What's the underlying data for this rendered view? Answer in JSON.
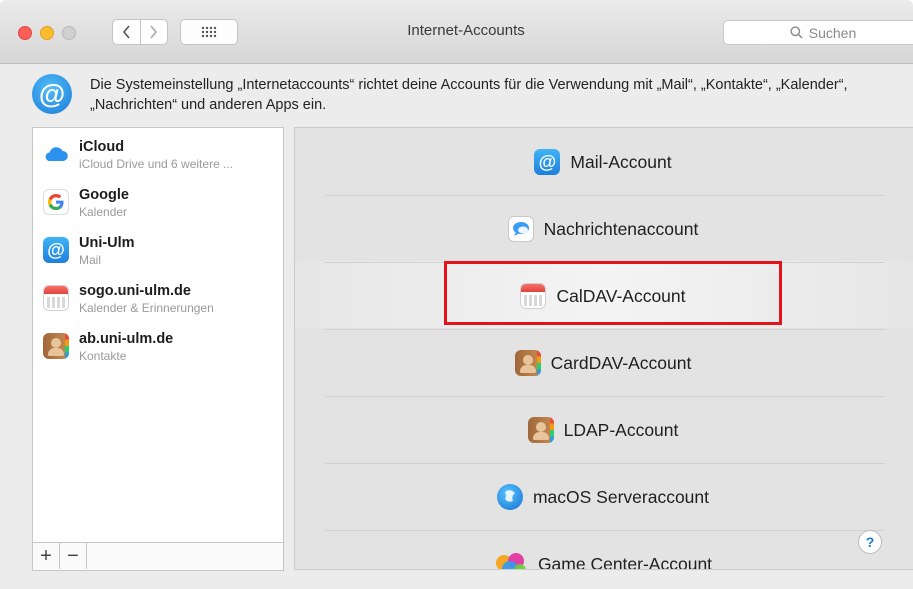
{
  "window": {
    "title": "Internet-Accounts",
    "search_placeholder": "Suchen"
  },
  "description": {
    "text": "Die Systemeinstellung „Internetaccounts“ richtet deine Accounts für die Verwendung mit „Mail“, „Kontakte“, „Kalender“, „Nachrichten“ und anderen Apps ein."
  },
  "accounts": [
    {
      "name": "iCloud",
      "detail": "iCloud Drive und 6 weitere ...",
      "icon": "icloud-icon"
    },
    {
      "name": "Google",
      "detail": "Kalender",
      "icon": "google-icon"
    },
    {
      "name": "Uni-Ulm",
      "detail": "Mail",
      "icon": "mail-icon"
    },
    {
      "name": "sogo.uni-ulm.de",
      "detail": "Kalender & Erinnerungen",
      "icon": "calendar-icon"
    },
    {
      "name": "ab.uni-ulm.de",
      "detail": "Kontakte",
      "icon": "contacts-icon"
    }
  ],
  "list_toolbar": {
    "add_label": "+",
    "remove_label": "−"
  },
  "providers": [
    {
      "label": "Mail-Account",
      "icon": "mail-icon"
    },
    {
      "label": "Nachrichtenaccount",
      "icon": "messages-icon"
    },
    {
      "label": "CalDAV-Account",
      "icon": "calendar-icon"
    },
    {
      "label": "CardDAV-Account",
      "icon": "contacts-icon"
    },
    {
      "label": "LDAP-Account",
      "icon": "contacts-icon"
    },
    {
      "label": "macOS Serveraccount",
      "icon": "server-icon"
    },
    {
      "label": "Game Center-Account",
      "icon": "game-center-icon"
    }
  ],
  "help_label": "?",
  "colors": {
    "highlight_box": "#e3131c",
    "accent": "#1a7ad8"
  }
}
